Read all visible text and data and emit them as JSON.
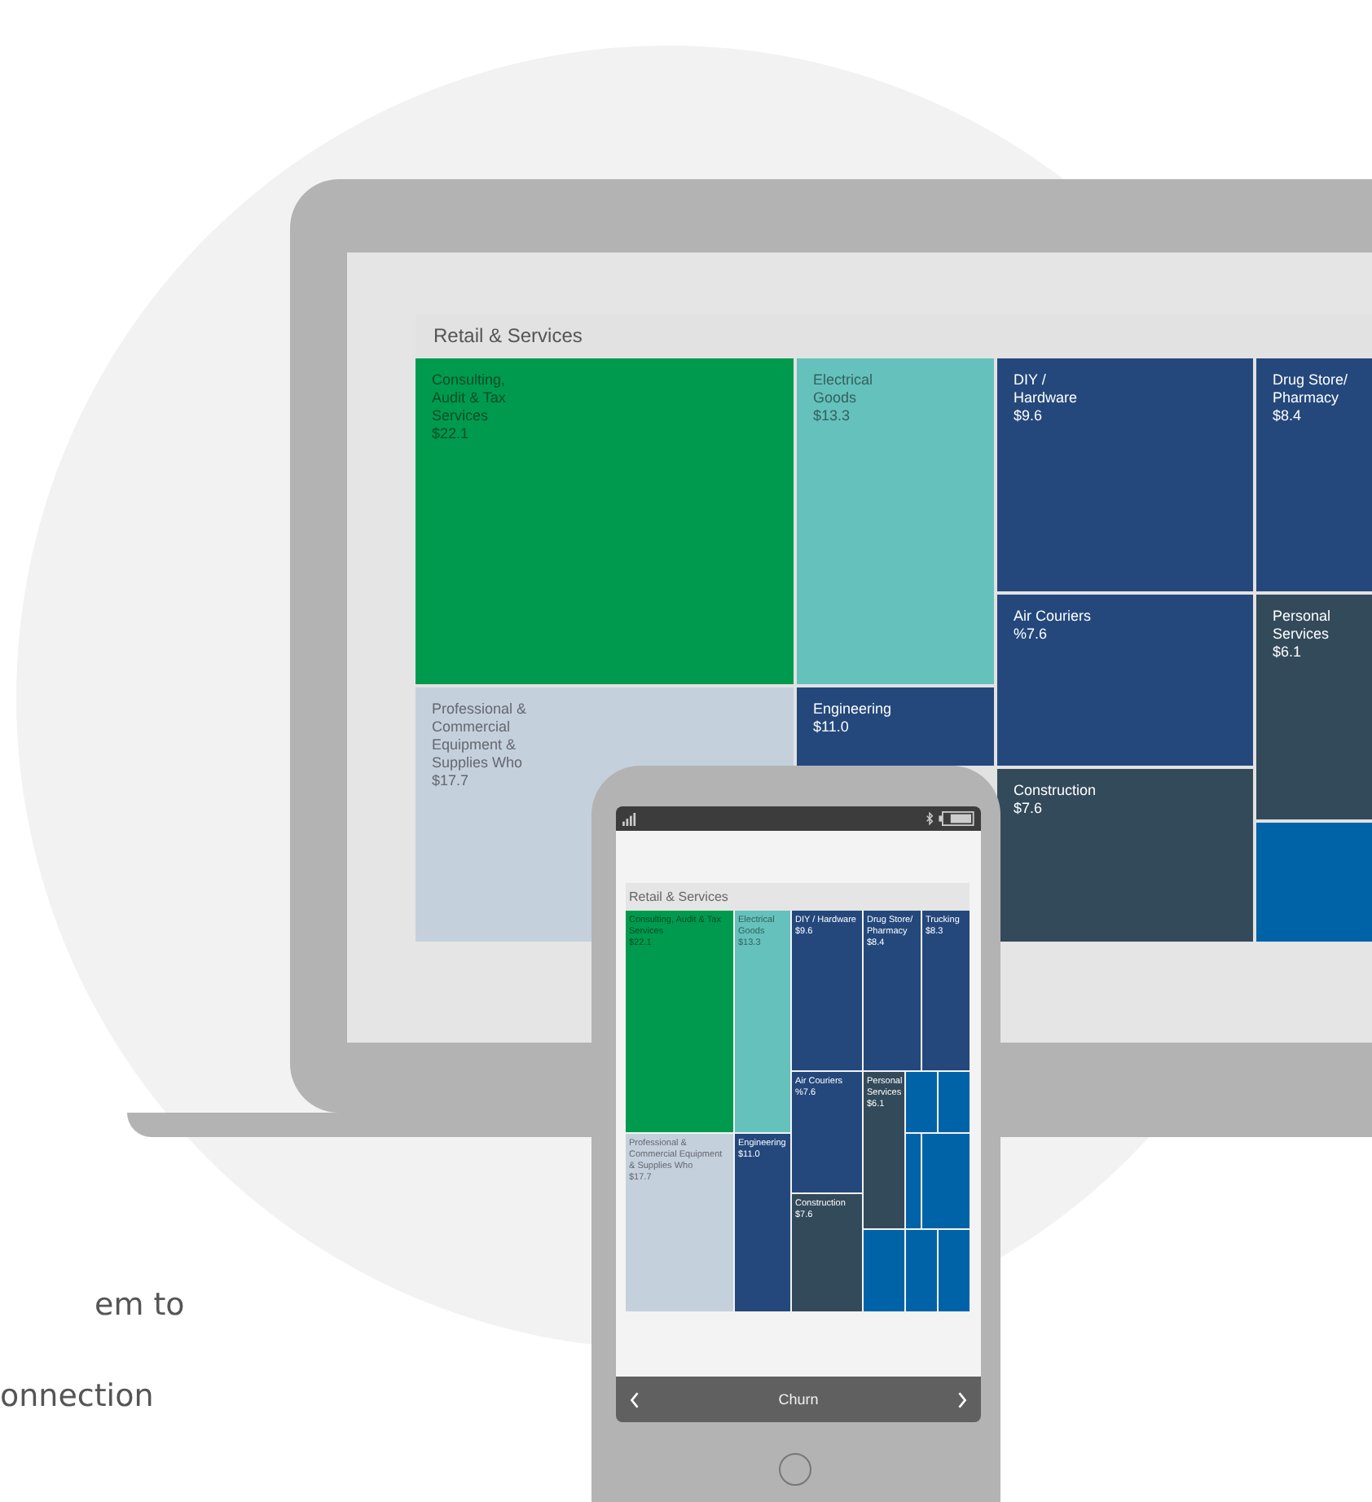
{
  "laptop": {
    "title": "Retail & Services",
    "tiles": [
      {
        "label": "Consulting, Audit & Tax Services",
        "value": "$22.1",
        "color": "#009a4e"
      },
      {
        "label": "Electrical Goods",
        "value": "$13.3",
        "color": "#65c1bc"
      },
      {
        "label": "DIY / Hardware",
        "value": "$9.6",
        "color": "#24487c"
      },
      {
        "label": "Drug Store/ Pharmacy",
        "value": "$8.4",
        "color": "#24487c"
      },
      {
        "label": "Professional & Commercial Equipment & Supplies Who",
        "value": "$17.7",
        "color": "#c5d0dd"
      },
      {
        "label": "Engineering",
        "value": "$11.0",
        "color": "#24487c"
      },
      {
        "label": "Air Couriers",
        "value": "%7.6",
        "color": "#24487c"
      },
      {
        "label": "Personal Services",
        "value": "$6.1",
        "color": "#334a5a"
      },
      {
        "label": "Construction",
        "value": "$7.6",
        "color": "#334a5a"
      },
      {
        "color": "#0063a8"
      }
    ]
  },
  "phone": {
    "title": "Retail & Services",
    "tiles": [
      {
        "label": "Consulting, Audit & Tax Services",
        "value": "$22.1",
        "color": "#009a4e"
      },
      {
        "label": "Electrical Goods",
        "value": "$13.3",
        "color": "#65c1bc"
      },
      {
        "label": "DIY / Hardware",
        "value": "$9.6",
        "color": "#24487c"
      },
      {
        "label": "Drug Store/ Pharmacy",
        "value": "$8.4",
        "color": "#24487c"
      },
      {
        "label": "Trucking",
        "value": "$8.3",
        "color": "#24487c"
      },
      {
        "label": "Professional & Commercial Equipment & Supplies Who",
        "value": "$17.7",
        "color": "#c5d0dd"
      },
      {
        "label": "Engineering",
        "value": "$11.0",
        "color": "#24487c"
      },
      {
        "label": "Air Couriers",
        "value": "%7.6",
        "color": "#24487c"
      },
      {
        "label": "Personal Services",
        "value": "$6.1",
        "color": "#334a5a"
      },
      {
        "label": "Construction",
        "value": "$7.6",
        "color": "#334a5a"
      },
      {
        "color": "#0063a8"
      },
      {
        "color": "#0063a8"
      },
      {
        "color": "#0063a8"
      },
      {
        "color": "#0063a8"
      },
      {
        "color": "#0063a8"
      },
      {
        "color": "#0063a8"
      },
      {
        "color": "#0063a8"
      }
    ],
    "nav": {
      "label": "Churn"
    }
  },
  "page_text": [
    "em to",
    "onnection"
  ]
}
